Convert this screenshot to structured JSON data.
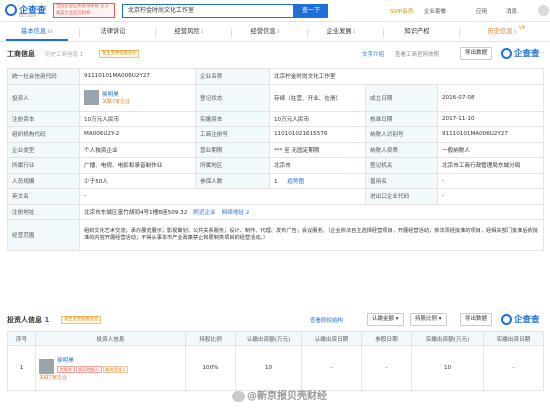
{
  "header": {
    "logo_text": "企查查",
    "logo_sub": "Qcc.com",
    "promo_text": "全国企业信用查询系统 官方备案企业征信机构",
    "search_value": "北京柠金时尚文化工作室",
    "search_button": "查一下",
    "vip_label": "SVIP会员",
    "nav_items": [
      "企业套餐",
      "应用",
      "消息"
    ]
  },
  "tabs": [
    {
      "label": "基本信息",
      "count": "16"
    },
    {
      "label": "法律诉讼",
      "count": ""
    },
    {
      "label": "经营风险",
      "count": "1"
    },
    {
      "label": "经营信息",
      "count": "3"
    },
    {
      "label": "企业发展",
      "count": "1"
    },
    {
      "label": "知识产权",
      "count": ""
    },
    {
      "label": "历史信息",
      "count": "1"
    }
  ],
  "vip_mini": "VIP",
  "business_info": {
    "title": "工商信息",
    "history_link": "历史工商信息 1",
    "badge": "发生变更提醒监控",
    "text_intro": "文字介绍",
    "source": "查看工商官网快照",
    "export_btn": "导出数据",
    "watermark": "企查查",
    "rows": {
      "credit_code_label": "统一社会信用代码",
      "credit_code": "91110101MA006U2Y27",
      "company_name_label": "企业名称",
      "company_name": "北京柠金时尚文化工作室",
      "investor_label": "投资人",
      "investor_name": "侯明昊",
      "investor_sub": "关联7家企业",
      "status_label": "登记状态",
      "status": "存续（在营、开业、在册）",
      "established_label": "成立日期",
      "established": "2016-07-08",
      "reg_capital_label": "注册资本",
      "reg_capital": "10万元人民币",
      "paid_capital_label": "实缴资本",
      "paid_capital": "10万元人民币",
      "approval_label": "核准日期",
      "approval": "2017-11-10",
      "org_code_label": "组织机构代码",
      "org_code": "MA006U2Y-2",
      "biz_reg_label": "工商注册号",
      "biz_reg": "110101021615576",
      "taxpayer_id_label": "纳税人识别号",
      "taxpayer_id": "91110101MA006U2Y27",
      "type_label": "企业类型",
      "type": "个人独资企业",
      "term_label": "营业期限",
      "term": "*** 至 无固定期限",
      "taxpayer_quality_label": "纳税人资质",
      "taxpayer_quality": "一般纳税人",
      "industry_label": "所属行业",
      "industry": "广播、电视、电影和录音制作业",
      "region_label": "所属地区",
      "region": "北京市",
      "authority_label": "登记机关",
      "authority": "北京市工商行政管理局东城分局",
      "staff_label": "人员规模",
      "staff": "少于50人",
      "insured_label": "参保人数",
      "insured": "1",
      "insured_trend": "趋势图",
      "former_name_label": "曾用名",
      "former_name": "-",
      "english_label": "英文名",
      "english": "-",
      "import_export_label": "进出口企业代码",
      "import_export": "-",
      "address_label": "注册地址",
      "address": "北京市东城区富竹胡同4号1幢B座509.32",
      "nearby": "附近企业",
      "online_addr": "网络地址 2",
      "scope_label": "经营范围",
      "scope": "组织文化艺术交流；承办展览展示；影视策划；公共关系服务；设计、制作、代理、发布广告；会议服务。（企业依法自主选择经营项目，开展经营活动；依法须经批准的项目，经相关部门批准后依批准的内容开展经营活动；不得从事本市产业政策禁止和限制类项目的经营活动。）"
    }
  },
  "shareholders": {
    "title": "投资人信息",
    "count": "1",
    "badge": "发生变更提醒监控",
    "equity_link": "查看股权结构",
    "filters": [
      "认缴金额",
      "持股比例"
    ],
    "export_btn": "导出数据",
    "watermark": "企查查",
    "columns": [
      "序号",
      "投资人信息",
      "持股比例",
      "认缴出资额(万元)",
      "认缴出资日期",
      "参股日期",
      "实缴出资额(万元)",
      "实缴出资日期"
    ],
    "rows": [
      {
        "index": "1",
        "name": "侯明昊",
        "tags": [
          "大股东",
          "实际控制人",
          "最终受益人"
        ],
        "sub": "关联7家企业",
        "ratio": "100%",
        "subscribed": "10",
        "sub_date": "-",
        "join_date": "-",
        "paid": "10",
        "paid_date": "-"
      }
    ]
  },
  "footer_watermark": "@新京报贝壳财经"
}
